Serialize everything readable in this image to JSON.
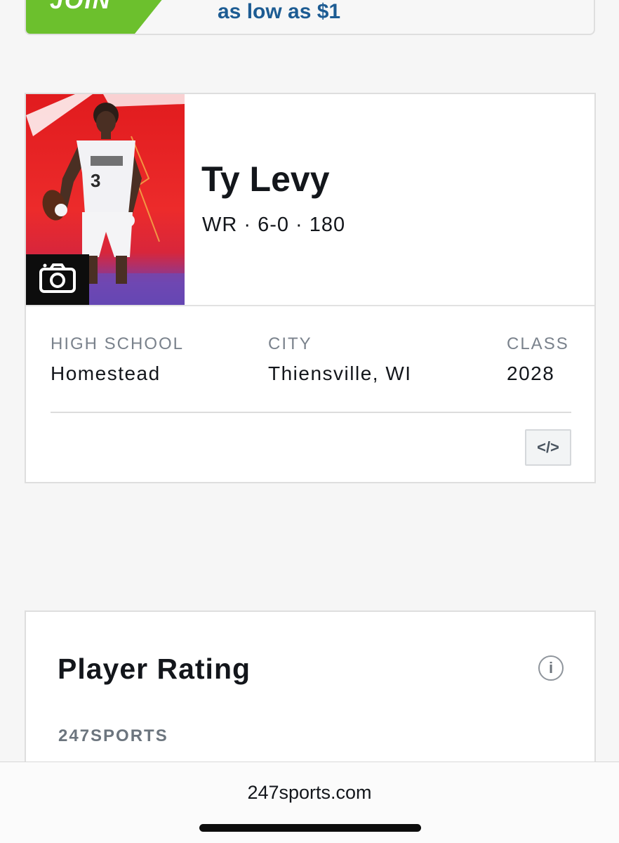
{
  "promo": {
    "join_label": "JOIN",
    "text": "as low as ",
    "price": "$1"
  },
  "player": {
    "name": "Ty Levy",
    "measurables": "WR · 6-0 · 180",
    "photo_jersey_number": "3",
    "high_school_label": "HIGH SCHOOL",
    "high_school": "Homestead",
    "city_label": "CITY",
    "city": "Thiensville, WI",
    "class_label": "CLASS",
    "class_year": "2028",
    "embed_label": "</>"
  },
  "rating": {
    "title": "Player Rating",
    "info_label": "i",
    "source": "247SPORTS"
  },
  "browser": {
    "url": "247sports.com"
  },
  "colors": {
    "join_green": "#6cc02d",
    "promo_blue": "#1d5c93",
    "photo_red": "#e11b1e",
    "photo_purple": "#5a3fa8"
  },
  "icons": [
    "camera-icon",
    "embed-code-icon",
    "info-icon"
  ]
}
